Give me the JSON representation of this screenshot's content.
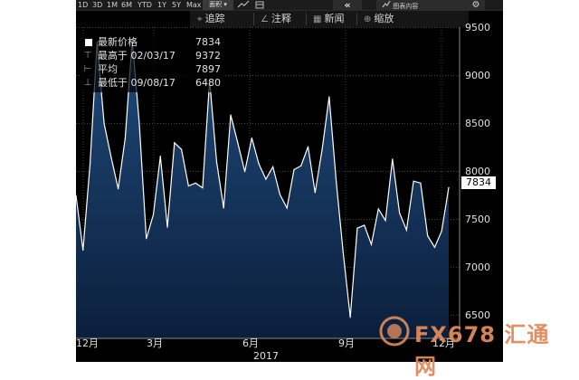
{
  "toolbar": {
    "ranges": [
      "1D",
      "3D",
      "1M",
      "6M",
      "YTD",
      "1Y",
      "5Y",
      "Max"
    ],
    "chart_type_label": "面积",
    "nav_arrows": "«",
    "related_label": "图表内容",
    "gear": "⚙"
  },
  "subbar": {
    "track": "追踪",
    "annotate": "注释",
    "news": "新闻",
    "zoom": "缩放"
  },
  "legend": {
    "latest": {
      "label": "最新价格",
      "value": "7834"
    },
    "high": {
      "label": "最高于 02/03/17",
      "value": "9372"
    },
    "average": {
      "label": "平均",
      "value": "7897"
    },
    "low": {
      "label": "最低于 09/08/17",
      "value": "6480"
    }
  },
  "chart_data": {
    "type": "area",
    "ylim": [
      6300,
      9700
    ],
    "y_ticks": [
      "9500",
      "9000",
      "8500",
      "8000",
      "7500",
      "7000",
      "6500"
    ],
    "x_ticks": [
      "12月",
      "3月",
      "6月",
      "9月",
      "12月"
    ],
    "x_year_label": "2017",
    "last_value_tag": "7834",
    "values": [
      7750,
      7180,
      8080,
      9350,
      8500,
      8150,
      7820,
      8350,
      9372,
      8500,
      7300,
      7550,
      8160,
      7420,
      8300,
      8230,
      7850,
      7880,
      7830,
      8950,
      8100,
      7620,
      8590,
      8300,
      8000,
      8350,
      8080,
      7920,
      8050,
      7760,
      7620,
      8020,
      8060,
      8260,
      7780,
      8230,
      8780,
      7900,
      7150,
      6480,
      7410,
      7440,
      7240,
      7610,
      7490,
      8130,
      7570,
      7390,
      7900,
      7880,
      7330,
      7210,
      7380,
      7834
    ],
    "colors": {
      "line": "#ffffff",
      "fill_top": "#1f4a7a",
      "fill_bottom": "#0b1f3c",
      "grid": "#6a6a6a"
    }
  },
  "watermark": {
    "text": "FX678 汇通网"
  }
}
